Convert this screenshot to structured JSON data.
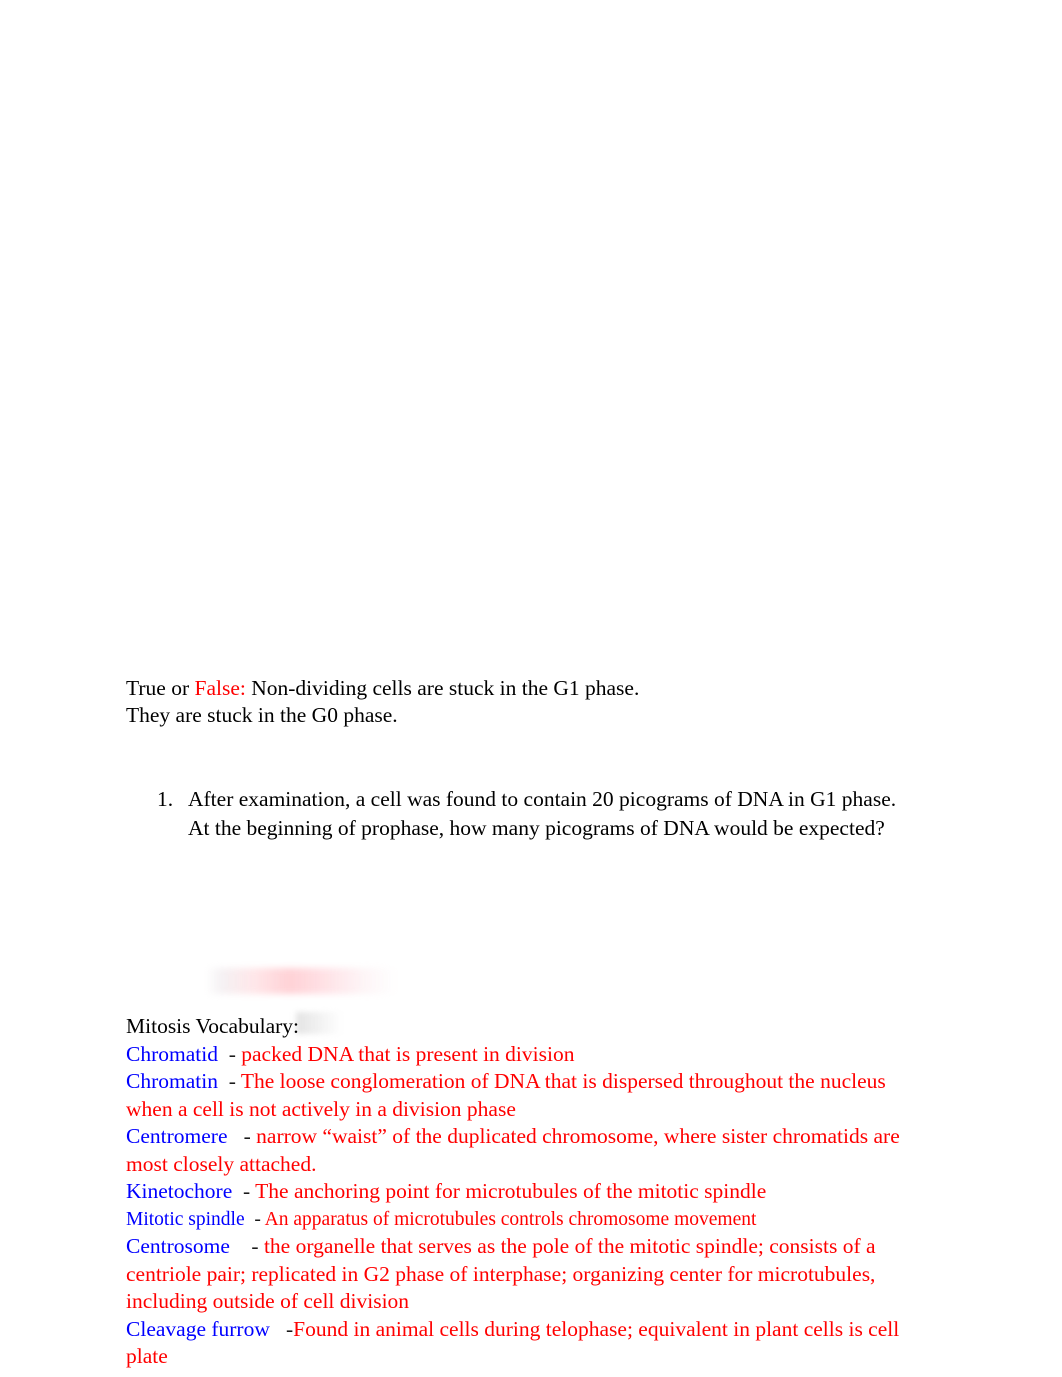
{
  "document": {
    "true_false": {
      "prefix": "True or",
      "gap1": "   ",
      "answer": "False:",
      "gap2": "   ",
      "statement": "Non-dividing cells are stuck in the G1 phase.",
      "explanation": "They are stuck in the G0 phase."
    },
    "questions": [
      {
        "number": "1.",
        "line1": "After examination, a cell was found to contain 20 picograms of DNA in G1 phase.",
        "line2": "At the beginning of prophase, how many picograms of DNA would be expected?"
      }
    ],
    "vocabulary": {
      "heading": "Mitosis Vocabulary:",
      "entries": [
        {
          "term": "Chromatid",
          "separator": "  - ",
          "definition": "packed DNA that is present in division"
        },
        {
          "term": "Chromatin",
          "separator": "  - ",
          "definition": "The loose conglomeration of DNA that is dispersed throughout the nucleus when a cell is not actively in a division phase"
        },
        {
          "term": "Centromere",
          "separator": "   - ",
          "definition": "narrow “waist” of the duplicated chromosome, where sister chromatids are most closely attached."
        },
        {
          "term": "Kinetochore",
          "separator": "  - ",
          "definition": "The anchoring point for microtubules of the mitotic spindle"
        },
        {
          "term": "Mitotic spindle",
          "separator": "  - ",
          "definition": "An apparatus of microtubules controls chromosome movement"
        },
        {
          "term": "Centrosome",
          "separator": "    - ",
          "definition": "the organelle that serves as the pole of the mitotic spindle; consists of a centriole pair; replicated in G2 phase of interphase; organizing center for microtubules, including outside of cell division"
        },
        {
          "term": "Cleavage furrow",
          "separator": "   -",
          "definition": "Found in animal cells during telophase; equivalent in plant cells is cell plate"
        }
      ]
    },
    "colors": {
      "term": "#0000ff",
      "definition": "#ff0000",
      "body": "#000000",
      "highlight": "#ff0000",
      "page_background": "#ffffff"
    }
  }
}
